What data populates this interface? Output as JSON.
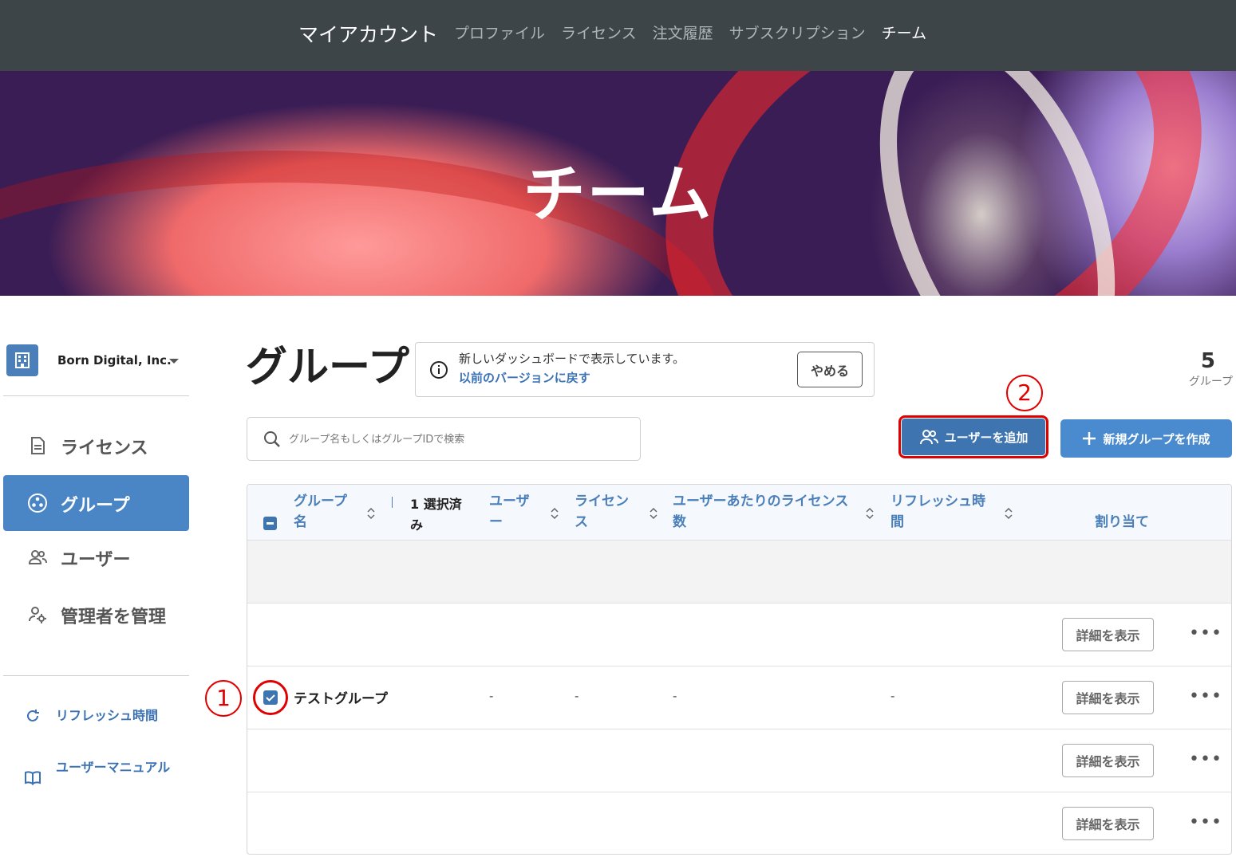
{
  "topnav": {
    "brand": "マイアカウント",
    "links": [
      "プロファイル",
      "ライセンス",
      "注文履歴",
      "サブスクリプション",
      "チーム"
    ]
  },
  "hero": {
    "title": "チーム"
  },
  "sidebar": {
    "org_name": "Born Digital, Inc.",
    "items": [
      {
        "label": "ライセンス",
        "icon": "document-icon"
      },
      {
        "label": "グループ",
        "icon": "group-icon"
      },
      {
        "label": "ユーザー",
        "icon": "users-icon"
      },
      {
        "label": "管理者を管理",
        "icon": "admin-gear-icon"
      }
    ],
    "links": [
      {
        "label": "リフレッシュ時間",
        "icon": "refresh-icon"
      },
      {
        "label": "ユーザーマニュアル",
        "icon": "book-icon"
      }
    ]
  },
  "main": {
    "title": "グループ",
    "notice": {
      "message": "新しいダッシュボードで表示しています。",
      "revert_link": "以前のバージョンに戻す",
      "stop_label": "やめる"
    },
    "count": {
      "value": "5",
      "unit": "グループ"
    },
    "search": {
      "placeholder": "グループ名もしくはグループIDで検索"
    },
    "add_user_label": "ユーザーを追加",
    "new_group_label": "新規グループを作成"
  },
  "callouts": {
    "one": "1",
    "two": "2"
  },
  "table": {
    "headers": {
      "group_name": "グループ名",
      "selected": "1 選択済み",
      "users": "ユーザー",
      "licenses": "ライセンス",
      "per_user": "ユーザーあたりのライセンス数",
      "refresh": "リフレッシュ時間",
      "assign": "割り当て"
    },
    "detail_label": "詳細を表示",
    "more_label": "•••",
    "rows": [
      {
        "name": "",
        "users": "",
        "licenses": "",
        "per_user": "",
        "refresh": ""
      },
      {
        "name": "テストグループ",
        "users": "-",
        "licenses": "-",
        "per_user": "-",
        "refresh": "-"
      },
      {
        "name": "",
        "users": "",
        "licenses": "",
        "per_user": "",
        "refresh": ""
      },
      {
        "name": "",
        "users": "",
        "licenses": "",
        "per_user": "",
        "refresh": ""
      }
    ]
  },
  "colors": {
    "accent": "#4a85c6",
    "highlight": "#e00000",
    "nav_bg": "#3e4549"
  }
}
